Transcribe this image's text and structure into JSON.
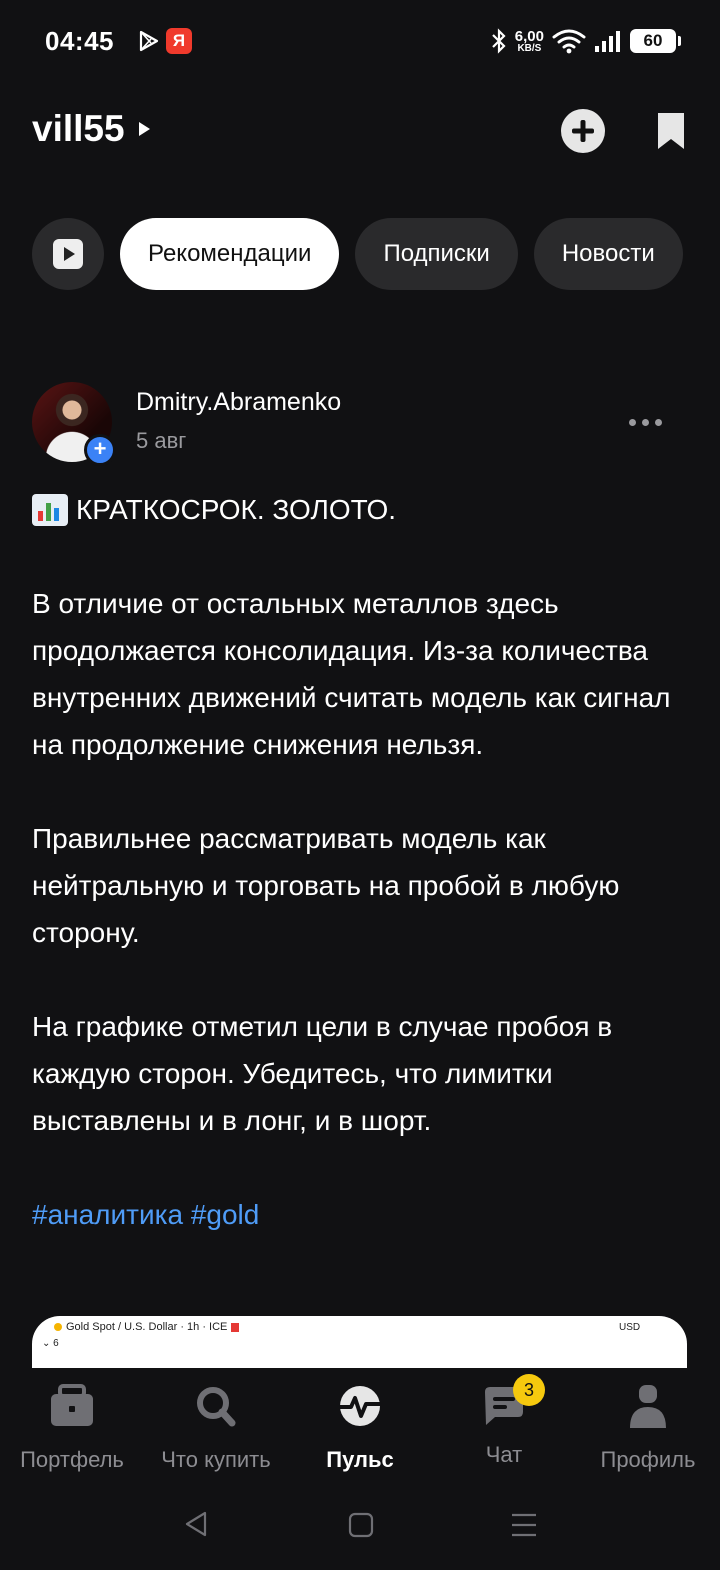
{
  "status_bar": {
    "time": "04:45",
    "yandex_badge": "Я",
    "net_speed_value": "6,00",
    "net_speed_unit": "KB/S",
    "battery": "60"
  },
  "header": {
    "account_name": "vill55"
  },
  "tabs": [
    {
      "label": "Рекомендации",
      "active": true
    },
    {
      "label": "Подписки",
      "active": false
    },
    {
      "label": "Новости",
      "active": false
    }
  ],
  "post": {
    "author": "Dmitry.Abramenko",
    "date": "5 авг",
    "title": "КРАТКОСРОК. ЗОЛОТО.",
    "paragraphs": [
      "В отличие от остальных металлов здесь продолжается консолидация. Из-за количества внутренних движений считать модель как сигнал на продолжение снижения нельзя.",
      "Правильнее рассматривать модель как нейтральную и торговать на пробой в любую сторону.",
      "На графике отметил цели в случае пробоя в каждую сторон. Убедитесь, что лимитки выставлены и в лонг, и в шорт."
    ],
    "tags": [
      "#аналитика",
      "#gold"
    ],
    "chart_preview": {
      "title": "Gold Spot / U.S. Dollar · 1h · ICE",
      "interval_selector": "6",
      "currency": "USD"
    }
  },
  "bottom_nav": [
    {
      "label": "Портфель",
      "icon": "briefcase-icon",
      "active": false
    },
    {
      "label": "Что купить",
      "icon": "search-icon",
      "active": false
    },
    {
      "label": "Пульс",
      "icon": "pulse-icon",
      "active": true
    },
    {
      "label": "Чат",
      "icon": "chat-icon",
      "active": false,
      "badge": "3"
    },
    {
      "label": "Профиль",
      "icon": "profile-icon",
      "active": false
    }
  ],
  "colors": {
    "background": "#111113",
    "accent_link": "#4f9cf7",
    "badge": "#f6c90e",
    "avatar_plus": "#3b82f6"
  }
}
